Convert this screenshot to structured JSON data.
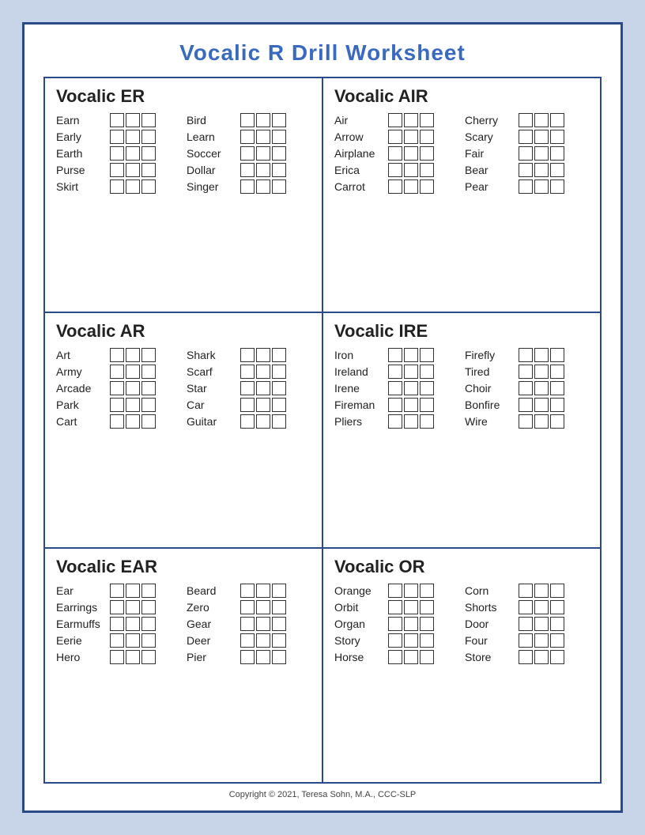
{
  "title": "Vocalic R Drill Worksheet",
  "sections": [
    {
      "id": "er",
      "heading": "Vocalic ER",
      "col1": [
        "Earn",
        "Early",
        "Earth",
        "Purse",
        "Skirt"
      ],
      "col2": [
        "Bird",
        "Learn",
        "Soccer",
        "Dollar",
        "Singer"
      ]
    },
    {
      "id": "air",
      "heading": "Vocalic AIR",
      "col1": [
        "Air",
        "Arrow",
        "Airplane",
        "Erica",
        "Carrot"
      ],
      "col2": [
        "Cherry",
        "Scary",
        "Fair",
        "Bear",
        "Pear"
      ]
    },
    {
      "id": "ar",
      "heading": "Vocalic AR",
      "col1": [
        "Art",
        "Army",
        "Arcade",
        "Park",
        "Cart"
      ],
      "col2": [
        "Shark",
        "Scarf",
        "Star",
        "Car",
        "Guitar"
      ]
    },
    {
      "id": "ire",
      "heading": "Vocalic IRE",
      "col1": [
        "Iron",
        "Ireland",
        "Irene",
        "Fireman",
        "Pliers"
      ],
      "col2": [
        "Firefly",
        "Tired",
        "Choir",
        "Bonfire",
        "Wire"
      ]
    },
    {
      "id": "ear",
      "heading": "Vocalic EAR",
      "col1": [
        "Ear",
        "Earrings",
        "Earmuffs",
        "Eerie",
        "Hero"
      ],
      "col2": [
        "Beard",
        "Zero",
        "Gear",
        "Deer",
        "Pier"
      ]
    },
    {
      "id": "or",
      "heading": "Vocalic OR",
      "col1": [
        "Orange",
        "Orbit",
        "Organ",
        "Story",
        "Horse"
      ],
      "col2": [
        "Corn",
        "Shorts",
        "Door",
        "Four",
        "Store"
      ]
    }
  ],
  "copyright": "Copyright © 2021, Teresa Sohn, M.A., CCC-SLP"
}
